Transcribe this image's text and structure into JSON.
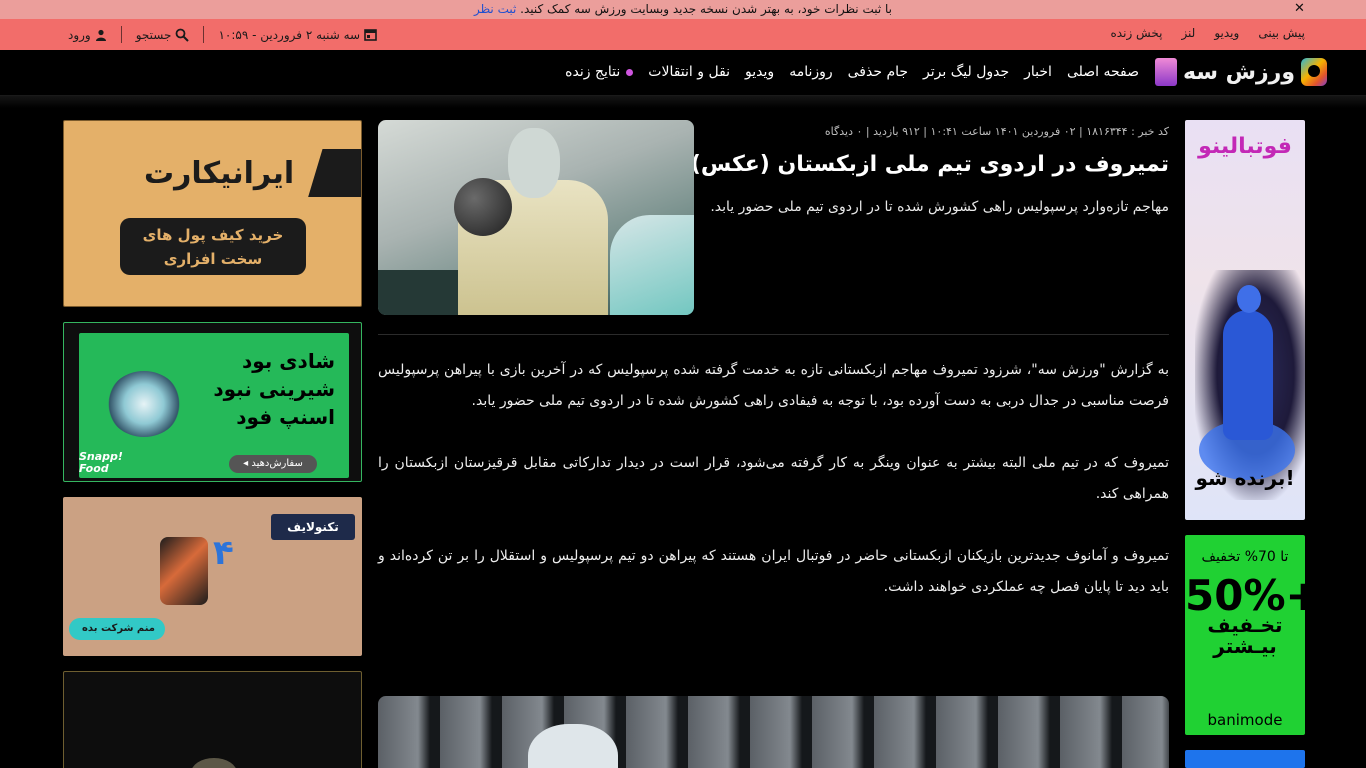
{
  "notice": {
    "text": "با ثبت نظرات خود، به بهتر شدن نسخه جدید وبسایت ورزش سه کمک کنید.",
    "link": "ثبت نظر",
    "close": "✕"
  },
  "topbar": {
    "links": [
      "پیش بینی",
      "ویدیو",
      "لنز",
      "پخش زنده"
    ],
    "date": "سه شنبه ۲ فروردین - ۱۰:۵۹",
    "search_label": "جستجو",
    "login_label": "ورود"
  },
  "nav": {
    "logo_text": "ورزش سه",
    "items": [
      "صفحه اصلی",
      "اخبار",
      "جدول لیگ برتر",
      "جام حذفی",
      "روزنامه",
      "ویدیو",
      "نقل و انتقالات",
      "نتایج زنده"
    ]
  },
  "article": {
    "meta": "کد خبر : ۱۸۱۶۳۴۴ | ۰۲ فروردین ۱۴۰۱ ساعت ۱۰:۴۱ | ۹۱۲ بازدید | ۰ دیدگاه",
    "title": "تمیروف در اردوی تیم ملی ازبکستان (عکس)",
    "lead": "مهاجم تازه‌وارد پرسپولیس راهی کشورش شده تا در اردوی تیم ملی حضور یابد.",
    "paragraphs": [
      "به گزارش \"ورزش سه\"، شرزود تمیروف مهاجم ازبکستانی تازه به خدمت گرفته شده پرسپولیس که در آخرین بازی با پیراهن پرسپولیس فرصت مناسبی در جدال دربی به دست آورده بود، با توجه به فیفادی راهی کشورش شده تا در اردوی تیم ملی حضور یابد.",
      "تمیروف که در تیم ملی البته بیشتر به عنوان وینگر به کار گرفته می‌شود، قرار است در دیدار تدارکاتی مقابل قرقیزستان ازبکستان را همراهی کند.",
      "تمیروف و آمانوف جدیدترین بازیکنان ازبکستانی حاضر در فوتبال ایران هستند که پیراهن دو تیم پرسپولیس و استقلال را بر تن کرده‌اند و باید دید تا پایان فصل چه عملکردی خواهند داشت."
    ]
  },
  "ads": {
    "footballino": {
      "title": "فوتبالینو",
      "cta": "برنده شو!"
    },
    "banimode": {
      "small": "تا 70% تخفیف",
      "big": "50%+",
      "more": "تخـفیف بیـشتر",
      "brand": "banimode"
    },
    "iranicard": {
      "name": "ایرانیکارت",
      "button": "خرید کیف پول های سخت افزاری"
    },
    "snappfood": {
      "lines": "شادی بود شیرینی نبود اسنپ فود",
      "button": "سفارش‌دهید ◂",
      "brand": "Snapp! Food"
    },
    "technolife": {
      "logo": "تکنولایف",
      "number": "۴",
      "button": "منم شرکت بده"
    }
  },
  "colors": {
    "notice_bg": "#eb9e9b",
    "topbar_bg": "#f26d6a",
    "page_bg": "#000000",
    "live_dot": "#cf56df"
  },
  "icons": [
    "close-icon",
    "calendar-icon",
    "search-icon",
    "user-icon",
    "live-dot-icon"
  ]
}
